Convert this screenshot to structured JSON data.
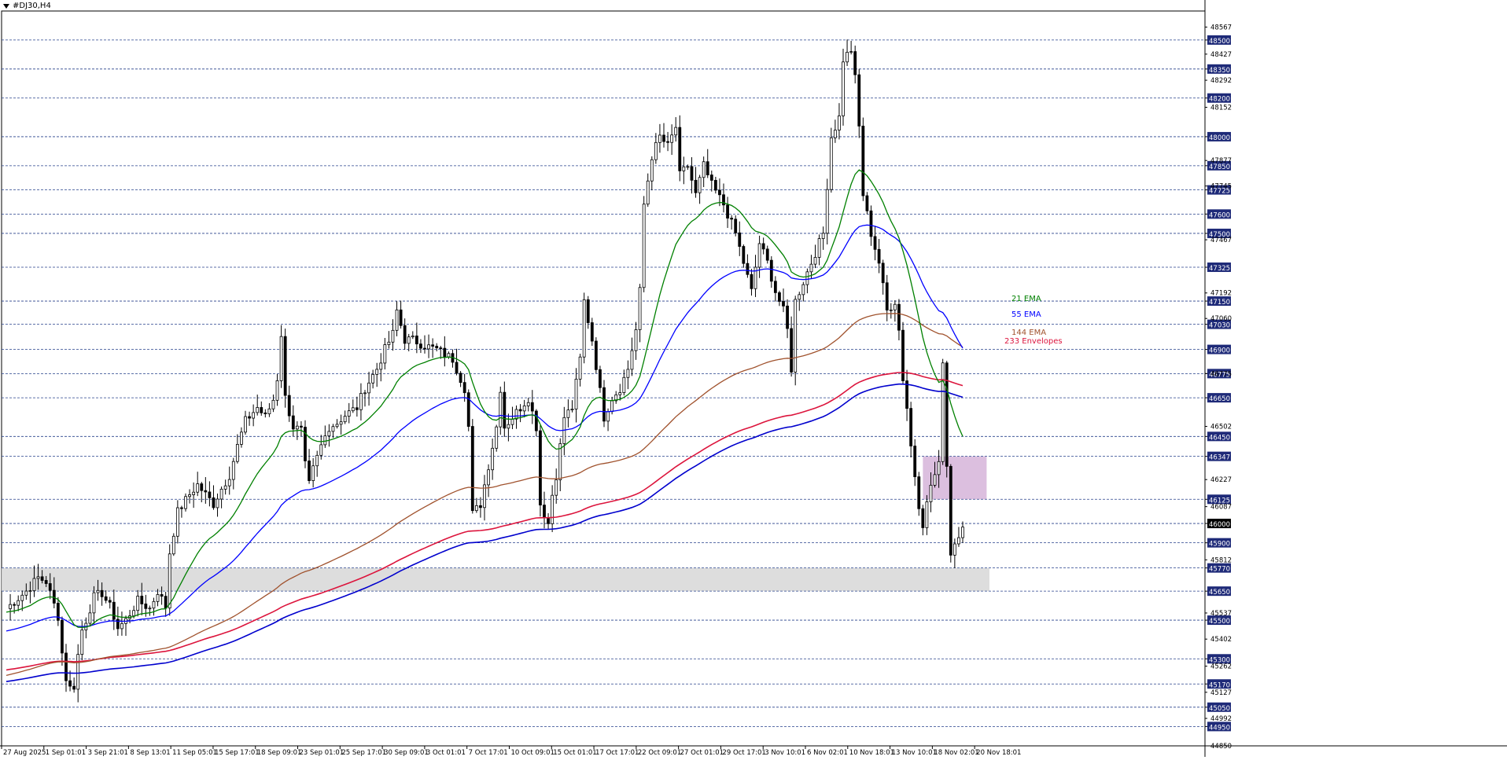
{
  "header": {
    "symbol": "#DJ30,H4"
  },
  "chart_data": {
    "type": "candlestick",
    "symbol": "#DJ30",
    "timeframe": "H4",
    "ylim": [
      44850,
      48650
    ],
    "gridlines": [
      48500,
      48350,
      48200,
      48000,
      47850,
      47725,
      47600,
      47500,
      47325,
      47150,
      47030,
      46900,
      46775,
      46650,
      46450,
      46347,
      46125,
      46000,
      45900,
      45770,
      45650,
      45500,
      45300,
      45170,
      45050,
      44950
    ],
    "axis_minor_labels": [
      "48567",
      "48427",
      "48292",
      "48152",
      "47877",
      "47745",
      "47467",
      "47192",
      "47060",
      "46775",
      "46502",
      "46227",
      "46087",
      "45812",
      "45537",
      "45402",
      "45262",
      "45127",
      "44992",
      "44850"
    ],
    "x_tick_labels": [
      "27 Aug 2025",
      "1 Sep 01:01",
      "3 Sep 21:01",
      "8 Sep 13:01",
      "11 Sep 05:01",
      "15 Sep 17:01",
      "18 Sep 09:01",
      "23 Sep 01:01",
      "25 Sep 17:01",
      "30 Sep 09:01",
      "3 Oct 01:01",
      "7 Oct 17:01",
      "10 Oct 09:01",
      "15 Oct 01:01",
      "17 Oct 17:01",
      "22 Oct 09:01",
      "27 Oct 01:01",
      "29 Oct 17:01",
      "3 Nov 10:01",
      "6 Nov 02:01",
      "10 Nov 18:01",
      "13 Nov 10:01",
      "18 Nov 02:01",
      "20 Nov 18:01"
    ],
    "price_path": [
      [
        0,
        45560
      ],
      [
        5,
        45650
      ],
      [
        8,
        45720
      ],
      [
        10,
        45700
      ],
      [
        11,
        45640
      ],
      [
        13,
        45520
      ],
      [
        14,
        45330
      ],
      [
        15,
        45200
      ],
      [
        16,
        45150
      ],
      [
        17,
        45160
      ],
      [
        18,
        45320
      ],
      [
        19,
        45450
      ],
      [
        20,
        45500
      ],
      [
        22,
        45620
      ],
      [
        24,
        45640
      ],
      [
        26,
        45570
      ],
      [
        27,
        45520
      ],
      [
        28,
        45460
      ],
      [
        30,
        45500
      ],
      [
        33,
        45600
      ],
      [
        36,
        45560
      ],
      [
        38,
        45650
      ],
      [
        40,
        45570
      ],
      [
        41,
        45850
      ],
      [
        43,
        46060
      ],
      [
        46,
        46150
      ],
      [
        48,
        46200
      ],
      [
        50,
        46150
      ],
      [
        52,
        46100
      ],
      [
        54,
        46180
      ],
      [
        56,
        46250
      ],
      [
        58,
        46400
      ],
      [
        60,
        46530
      ],
      [
        63,
        46600
      ],
      [
        65,
        46550
      ],
      [
        67,
        46640
      ],
      [
        68,
        46750
      ],
      [
        69,
        46980
      ],
      [
        70,
        46650
      ],
      [
        72,
        46500
      ],
      [
        74,
        46480
      ],
      [
        75,
        46300
      ],
      [
        76,
        46200
      ],
      [
        77,
        46280
      ],
      [
        79,
        46400
      ],
      [
        81,
        46500
      ],
      [
        83,
        46520
      ],
      [
        85,
        46560
      ],
      [
        88,
        46600
      ],
      [
        90,
        46700
      ],
      [
        93,
        46800
      ],
      [
        95,
        46900
      ],
      [
        97,
        46980
      ],
      [
        98,
        47100
      ],
      [
        100,
        46950
      ],
      [
        102,
        46950
      ],
      [
        105,
        46920
      ],
      [
        108,
        46900
      ],
      [
        112,
        46850
      ],
      [
        115,
        46700
      ],
      [
        116,
        46500
      ],
      [
        117,
        46050
      ],
      [
        119,
        46100
      ],
      [
        121,
        46300
      ],
      [
        123,
        46500
      ],
      [
        124,
        46700
      ],
      [
        125,
        46500
      ],
      [
        127,
        46550
      ],
      [
        129,
        46600
      ],
      [
        131,
        46650
      ],
      [
        133,
        46500
      ],
      [
        134,
        46100
      ],
      [
        136,
        46000
      ],
      [
        137,
        46150
      ],
      [
        138,
        46250
      ],
      [
        140,
        46550
      ],
      [
        142,
        46600
      ],
      [
        144,
        46850
      ],
      [
        145,
        47150
      ],
      [
        147,
        46950
      ],
      [
        150,
        46550
      ],
      [
        152,
        46650
      ],
      [
        154,
        46700
      ],
      [
        156,
        46800
      ],
      [
        158,
        47000
      ],
      [
        159,
        47200
      ],
      [
        160,
        47650
      ],
      [
        162,
        47900
      ],
      [
        164,
        48000
      ],
      [
        166,
        47950
      ],
      [
        168,
        48050
      ],
      [
        169,
        47800
      ],
      [
        171,
        47850
      ],
      [
        173,
        47700
      ],
      [
        175,
        47850
      ],
      [
        177,
        47750
      ],
      [
        180,
        47650
      ],
      [
        183,
        47500
      ],
      [
        185,
        47350
      ],
      [
        187,
        47200
      ],
      [
        189,
        47450
      ],
      [
        191,
        47350
      ],
      [
        193,
        47200
      ],
      [
        195,
        47100
      ],
      [
        196,
        47000
      ],
      [
        197,
        46800
      ],
      [
        198,
        47150
      ],
      [
        201,
        47300
      ],
      [
        203,
        47400
      ],
      [
        205,
        47500
      ],
      [
        207,
        48000
      ],
      [
        209,
        48100
      ],
      [
        210,
        48400
      ],
      [
        212,
        48450
      ],
      [
        213,
        48300
      ],
      [
        214,
        48050
      ],
      [
        215,
        47700
      ],
      [
        217,
        47500
      ],
      [
        219,
        47350
      ],
      [
        221,
        47100
      ],
      [
        223,
        47150
      ],
      [
        224,
        47000
      ],
      [
        225,
        46750
      ],
      [
        226,
        46600
      ],
      [
        227,
        46400
      ],
      [
        228,
        46250
      ],
      [
        229,
        46100
      ],
      [
        230,
        46000
      ],
      [
        232,
        46200
      ],
      [
        234,
        46300
      ],
      [
        235,
        46850
      ],
      [
        236,
        46300
      ],
      [
        237,
        45850
      ],
      [
        238,
        45900
      ],
      [
        240,
        46000
      ]
    ],
    "indicators": [
      {
        "name": "21 EMA",
        "color": "#008000"
      },
      {
        "name": "55 EMA",
        "color": "#0000ff"
      },
      {
        "name": "144 EMA",
        "color": "#a0522d"
      },
      {
        "name": "233 Envelopes",
        "color": "#dc143c"
      }
    ],
    "zones": [
      {
        "name": "support-zone",
        "y_low": 45650,
        "y_high": 45770,
        "color": "#d9d9d9"
      },
      {
        "name": "resistance-zone",
        "y_low": 46125,
        "y_high": 46347,
        "color": "#d8b8dc"
      }
    ],
    "current_price_label": "46000"
  }
}
